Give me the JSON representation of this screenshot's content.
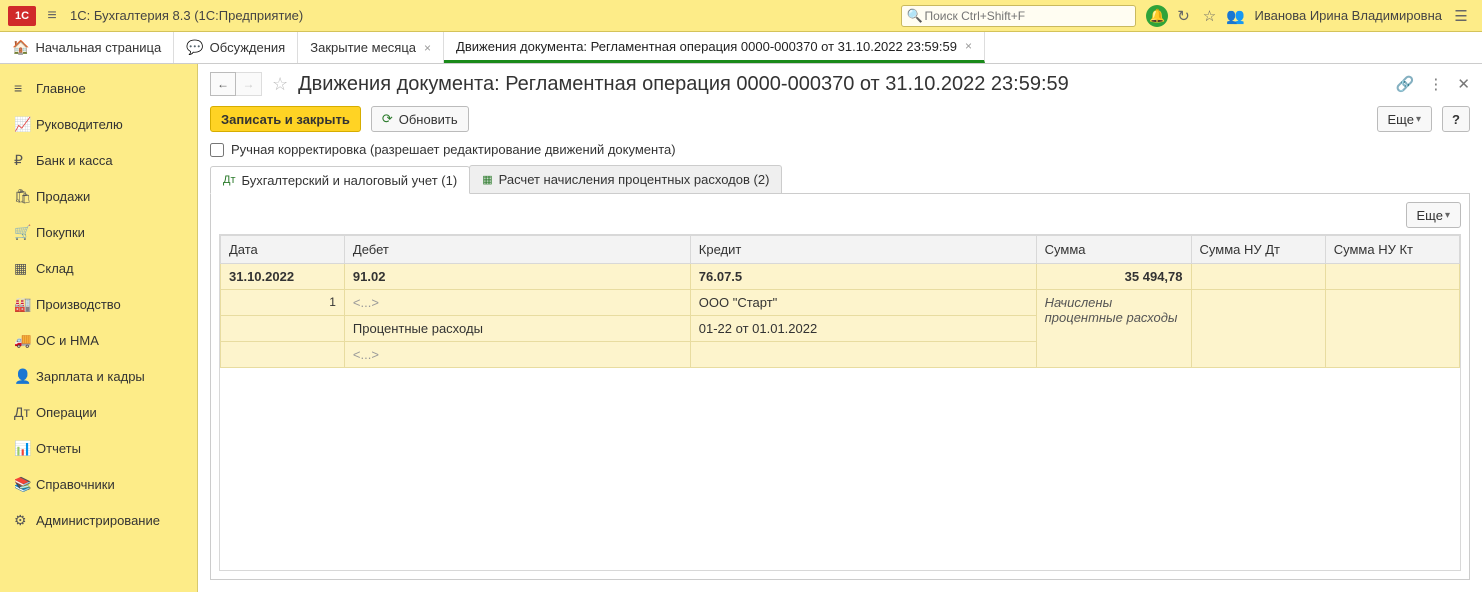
{
  "titlebar": {
    "logo_text": "1С",
    "app_title": "1С: Бухгалтерия 8.3  (1С:Предприятие)",
    "search_placeholder": "Поиск Ctrl+Shift+F",
    "user_name": "Иванова Ирина Владимировна"
  },
  "tabs": [
    {
      "icon": "🏠",
      "label": "Начальная страница",
      "closable": false,
      "active": false
    },
    {
      "icon": "💬",
      "label": "Обсуждения",
      "closable": false,
      "active": false
    },
    {
      "icon": "",
      "label": "Закрытие месяца",
      "closable": true,
      "active": false
    },
    {
      "icon": "",
      "label": "Движения документа: Регламентная операция 0000-000370 от 31.10.2022 23:59:59",
      "closable": true,
      "active": true
    }
  ],
  "sidebar": [
    {
      "icon": "≡",
      "label": "Главное"
    },
    {
      "icon": "📈",
      "label": "Руководителю"
    },
    {
      "icon": "₽",
      "label": "Банк и касса"
    },
    {
      "icon": "🛍",
      "label": "Продажи"
    },
    {
      "icon": "🛒",
      "label": "Покупки"
    },
    {
      "icon": "▦",
      "label": "Склад"
    },
    {
      "icon": "🏭",
      "label": "Производство"
    },
    {
      "icon": "🚚",
      "label": "ОС и НМА"
    },
    {
      "icon": "👤",
      "label": "Зарплата и кадры"
    },
    {
      "icon": "Дт",
      "label": "Операции"
    },
    {
      "icon": "📊",
      "label": "Отчеты"
    },
    {
      "icon": "📚",
      "label": "Справочники"
    },
    {
      "icon": "⚙",
      "label": "Администрирование"
    }
  ],
  "header": {
    "title": "Движения документа: Регламентная операция 0000-000370 от 31.10.2022 23:59:59"
  },
  "toolbar": {
    "save_close": "Записать и закрыть",
    "refresh": "Обновить",
    "more": "Еще",
    "help": "?"
  },
  "manual_edit": {
    "label": "Ручная корректировка (разрешает редактирование движений документа)",
    "checked": false
  },
  "subtabs": [
    {
      "icon": "Дт",
      "label": "Бухгалтерский и налоговый учет (1)",
      "active": true
    },
    {
      "icon": "▦",
      "label": "Расчет начисления процентных расходов (2)",
      "active": false
    }
  ],
  "panel_more": "Еще",
  "grid": {
    "columns": {
      "date": "Дата",
      "debit": "Дебет",
      "credit": "Кредит",
      "sum": "Сумма",
      "sum_nu_dt": "Сумма НУ Дт",
      "sum_nu_kt": "Сумма НУ Кт"
    },
    "row1": {
      "date": "31.10.2022",
      "debit_acc": "91.02",
      "credit_acc": "76.07.5",
      "sum": "35 494,78"
    },
    "row2": {
      "line_no": "1",
      "debit_sub1": "<...>",
      "credit_sub1": "ООО \"Старт\"",
      "comment": "Начислены процентные расходы"
    },
    "row3": {
      "debit_sub2": "Процентные расходы",
      "credit_sub2": "01-22 от 01.01.2022"
    },
    "row4": {
      "debit_sub3": "<...>"
    }
  }
}
